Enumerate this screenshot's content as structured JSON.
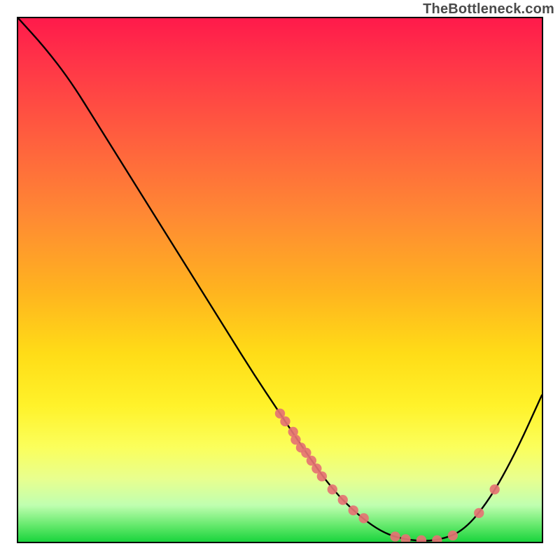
{
  "watermark": "TheBottleneck.com",
  "chart_data": {
    "type": "line",
    "title": "",
    "xlabel": "",
    "ylabel": "",
    "xlim": [
      0,
      100
    ],
    "ylim": [
      0,
      100
    ],
    "grid": false,
    "series": [
      {
        "name": "curve",
        "x": [
          0,
          5,
          10,
          15,
          20,
          25,
          30,
          35,
          40,
          45,
          50,
          55,
          60,
          65,
          70,
          75,
          80,
          85,
          90,
          95,
          100
        ],
        "y": [
          100,
          94.5,
          88,
          80,
          72,
          64,
          56,
          48,
          40,
          32,
          24.5,
          17,
          10,
          5,
          1.5,
          0.2,
          0.2,
          2,
          8,
          17,
          28
        ],
        "color": "#000000"
      },
      {
        "name": "scatter-points",
        "type": "scatter",
        "x": [
          50,
          51,
          52.5,
          53,
          54,
          55,
          56,
          57,
          58,
          60,
          62,
          64,
          66,
          72,
          74,
          77,
          80,
          83,
          88,
          91
        ],
        "y": [
          24.5,
          23,
          21,
          19.5,
          18,
          17,
          15.5,
          14,
          12.5,
          10,
          8,
          6,
          4.5,
          1,
          0.5,
          0.3,
          0.3,
          1.2,
          5.5,
          10
        ],
        "color": "#e57373"
      }
    ]
  }
}
